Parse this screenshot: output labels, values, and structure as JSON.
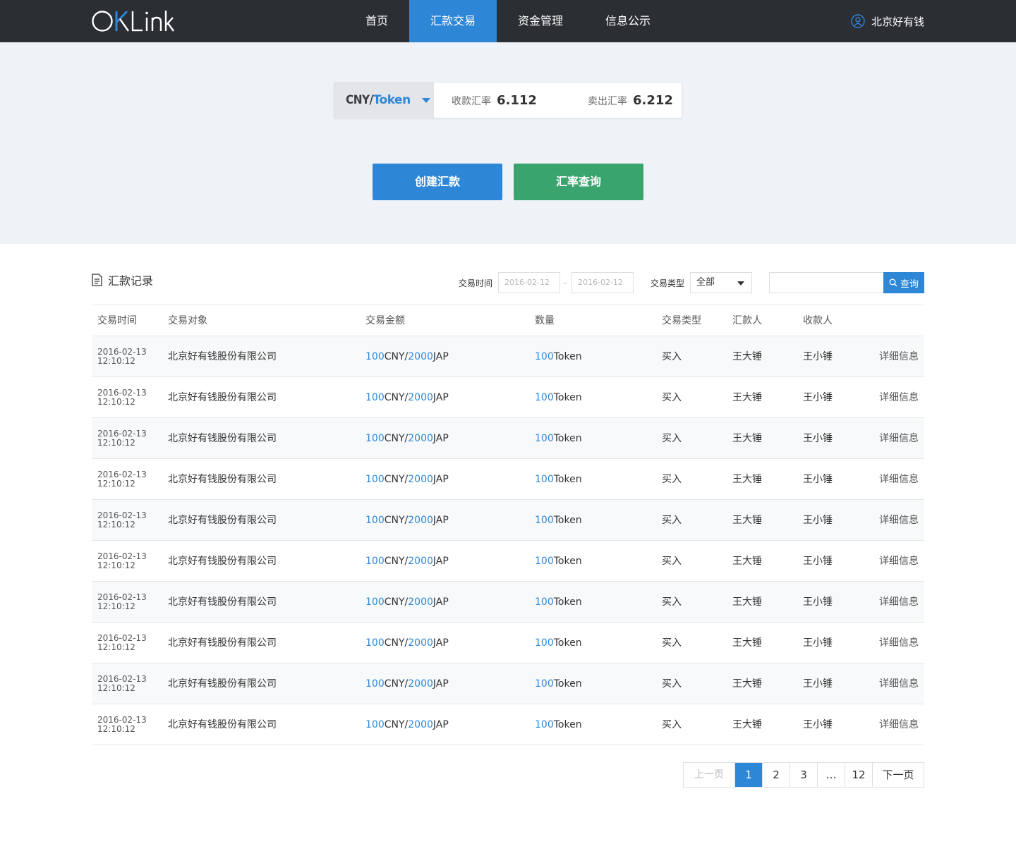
{
  "header": {
    "logo": "OKLink",
    "nav": [
      {
        "label": "首页",
        "active": false
      },
      {
        "label": "汇款交易",
        "active": true
      },
      {
        "label": "资金管理",
        "active": false
      },
      {
        "label": "信息公示",
        "active": false
      }
    ],
    "user_name": "北京好有钱"
  },
  "hero": {
    "pair_base": "CNY/",
    "pair_quote": "Token",
    "buy_rate_label": "收款汇率",
    "buy_rate_value": "6.112",
    "sell_rate_label": "卖出汇率",
    "sell_rate_value": "6.212",
    "create_button": "创建汇款",
    "rate_query_button": "汇率查询"
  },
  "records": {
    "title": "汇款记录",
    "filters": {
      "time_label": "交易时间",
      "date_from_placeholder": "2016-02-12",
      "date_to_placeholder": "2016-02-12",
      "date_separator": "–",
      "type_label": "交易类型",
      "type_selected": "全部",
      "search_button": "查询",
      "search_value": ""
    },
    "columns": [
      "交易时间",
      "交易对象",
      "交易金额",
      "数量",
      "交易类型",
      "汇款人",
      "收款人"
    ],
    "rows": [
      {
        "date": "2016-02-13",
        "time": "12:10:12",
        "counterparty": "北京好有钱股份有限公司",
        "amount_cny": "100",
        "cny_unit": "CNY",
        "slash": "/",
        "amount_jap": "2000",
        "jap_unit": "JAP",
        "qty": "100",
        "qty_unit": "Token",
        "type": "买入",
        "sender": "王大锤",
        "receiver": "王小锤",
        "detail": "详细信息"
      },
      {
        "date": "2016-02-13",
        "time": "12:10:12",
        "counterparty": "北京好有钱股份有限公司",
        "amount_cny": "100",
        "cny_unit": "CNY",
        "slash": "/",
        "amount_jap": "2000",
        "jap_unit": "JAP",
        "qty": "100",
        "qty_unit": "Token",
        "type": "买入",
        "sender": "王大锤",
        "receiver": "王小锤",
        "detail": "详细信息"
      },
      {
        "date": "2016-02-13",
        "time": "12:10:12",
        "counterparty": "北京好有钱股份有限公司",
        "amount_cny": "100",
        "cny_unit": "CNY",
        "slash": "/",
        "amount_jap": "2000",
        "jap_unit": "JAP",
        "qty": "100",
        "qty_unit": "Token",
        "type": "买入",
        "sender": "王大锤",
        "receiver": "王小锤",
        "detail": "详细信息"
      },
      {
        "date": "2016-02-13",
        "time": "12:10:12",
        "counterparty": "北京好有钱股份有限公司",
        "amount_cny": "100",
        "cny_unit": "CNY",
        "slash": "/",
        "amount_jap": "2000",
        "jap_unit": "JAP",
        "qty": "100",
        "qty_unit": "Token",
        "type": "买入",
        "sender": "王大锤",
        "receiver": "王小锤",
        "detail": "详细信息"
      },
      {
        "date": "2016-02-13",
        "time": "12:10:12",
        "counterparty": "北京好有钱股份有限公司",
        "amount_cny": "100",
        "cny_unit": "CNY",
        "slash": "/",
        "amount_jap": "2000",
        "jap_unit": "JAP",
        "qty": "100",
        "qty_unit": "Token",
        "type": "买入",
        "sender": "王大锤",
        "receiver": "王小锤",
        "detail": "详细信息"
      },
      {
        "date": "2016-02-13",
        "time": "12:10:12",
        "counterparty": "北京好有钱股份有限公司",
        "amount_cny": "100",
        "cny_unit": "CNY",
        "slash": "/",
        "amount_jap": "2000",
        "jap_unit": "JAP",
        "qty": "100",
        "qty_unit": "Token",
        "type": "买入",
        "sender": "王大锤",
        "receiver": "王小锤",
        "detail": "详细信息"
      },
      {
        "date": "2016-02-13",
        "time": "12:10:12",
        "counterparty": "北京好有钱股份有限公司",
        "amount_cny": "100",
        "cny_unit": "CNY",
        "slash": "/",
        "amount_jap": "2000",
        "jap_unit": "JAP",
        "qty": "100",
        "qty_unit": "Token",
        "type": "买入",
        "sender": "王大锤",
        "receiver": "王小锤",
        "detail": "详细信息"
      },
      {
        "date": "2016-02-13",
        "time": "12:10:12",
        "counterparty": "北京好有钱股份有限公司",
        "amount_cny": "100",
        "cny_unit": "CNY",
        "slash": "/",
        "amount_jap": "2000",
        "jap_unit": "JAP",
        "qty": "100",
        "qty_unit": "Token",
        "type": "买入",
        "sender": "王大锤",
        "receiver": "王小锤",
        "detail": "详细信息"
      },
      {
        "date": "2016-02-13",
        "time": "12:10:12",
        "counterparty": "北京好有钱股份有限公司",
        "amount_cny": "100",
        "cny_unit": "CNY",
        "slash": "/",
        "amount_jap": "2000",
        "jap_unit": "JAP",
        "qty": "100",
        "qty_unit": "Token",
        "type": "买入",
        "sender": "王大锤",
        "receiver": "王小锤",
        "detail": "详细信息"
      },
      {
        "date": "2016-02-13",
        "time": "12:10:12",
        "counterparty": "北京好有钱股份有限公司",
        "amount_cny": "100",
        "cny_unit": "CNY",
        "slash": "/",
        "amount_jap": "2000",
        "jap_unit": "JAP",
        "qty": "100",
        "qty_unit": "Token",
        "type": "买入",
        "sender": "王大锤",
        "receiver": "王小锤",
        "detail": "详细信息"
      }
    ]
  },
  "pagination": {
    "prev": "上一页",
    "pages": [
      "1",
      "2",
      "3",
      "…",
      "12"
    ],
    "current": "1",
    "next": "下一页"
  },
  "colors": {
    "topbar": "#2b2e33",
    "accent_blue": "#2e86d6",
    "accent_green": "#3aa46f",
    "hero_bg": "#eff3f7"
  },
  "icons": {
    "user": "user-icon",
    "records": "document-icon",
    "search": "search-icon",
    "pair_dropdown": "caret-down-icon",
    "type_dropdown": "caret-down-icon"
  }
}
